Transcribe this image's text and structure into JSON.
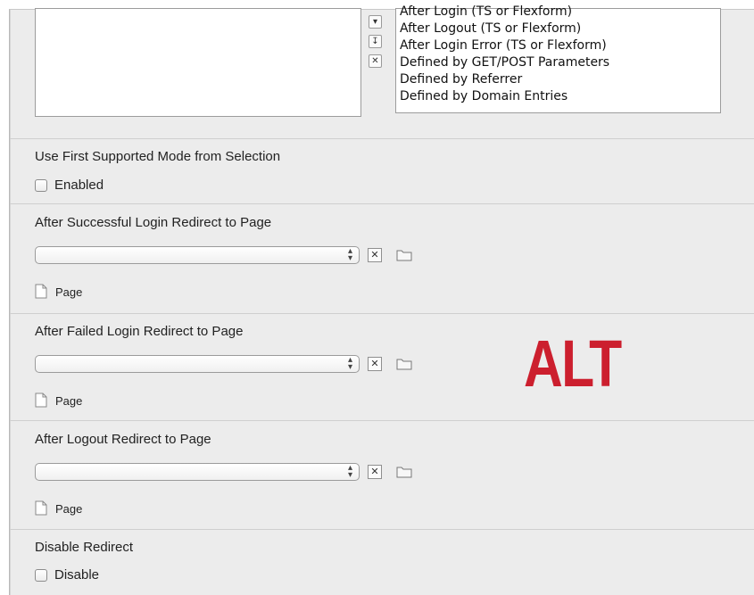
{
  "redirect_modes": {
    "options": [
      "After Login (TS or Flexform)",
      "After Logout (TS or Flexform)",
      "After Login Error (TS or Flexform)",
      "Defined by GET/POST Parameters",
      "Defined by Referrer",
      "Defined by Domain Entries"
    ],
    "buttons": [
      "move-down",
      "move-to-bottom",
      "remove"
    ]
  },
  "first_supported": {
    "label": "Use First Supported Mode from Selection",
    "checkbox_label": "Enabled",
    "checked": false
  },
  "success_redirect": {
    "label": "After Successful Login Redirect to Page",
    "select_value": "",
    "page_label": "Page"
  },
  "failed_redirect": {
    "label": "After Failed Login Redirect to Page",
    "select_value": "",
    "page_label": "Page"
  },
  "logout_redirect": {
    "label": "After Logout Redirect to Page",
    "select_value": "",
    "page_label": "Page"
  },
  "disable_redirect": {
    "label": "Disable Redirect",
    "checkbox_label": "Disable",
    "checked": false
  },
  "badge": {
    "text": "ALT",
    "color": "#cc1f2e"
  },
  "icons": {
    "select_arrows": "updown-arrows-icon",
    "clear": "clear-x-icon",
    "browse": "folder-icon",
    "page": "page-icon"
  }
}
